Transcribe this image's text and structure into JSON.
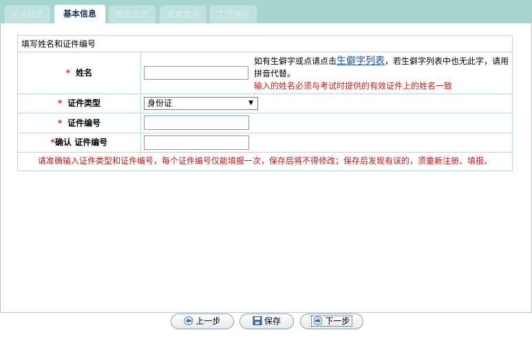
{
  "tabs": [
    {
      "label": "考点信息",
      "active": false
    },
    {
      "label": "基本信息",
      "active": true
    },
    {
      "label": "联系方式",
      "active": false
    },
    {
      "label": "教育情况",
      "active": false
    },
    {
      "label": "工作情况",
      "active": false
    }
  ],
  "form": {
    "section_title": "填写姓名和证件编号",
    "name_label": "姓名",
    "name_value": "",
    "name_hint_prefix": "如有生僻字或点请点击",
    "name_hint_link": "生僻字列表",
    "name_hint_suffix": "，若生僻字列表中也无此字，请用拼音代替。",
    "name_hint_red": "输入的姓名必须与考试时提供的有效证件上的姓名一致",
    "id_type_label": "证件类型",
    "id_type_value": "身份证",
    "id_number_label": "证件编号",
    "id_number_value": "",
    "confirm_label": "确认 证件编号",
    "confirm_value": "",
    "required_mark": "*",
    "notice": "请准确输入证件类型和证件编号，每个证件编号仅能填报一次，保存后将不得修改；保存后发现有误的，须重新注册、填报。"
  },
  "buttons": {
    "prev": "上一步",
    "save": "保存",
    "next": "下一步"
  },
  "colors": {
    "tab_bar": "#a7d6d1",
    "required": "#d02020",
    "notice": "#b81818",
    "link": "#1a4fa0"
  }
}
